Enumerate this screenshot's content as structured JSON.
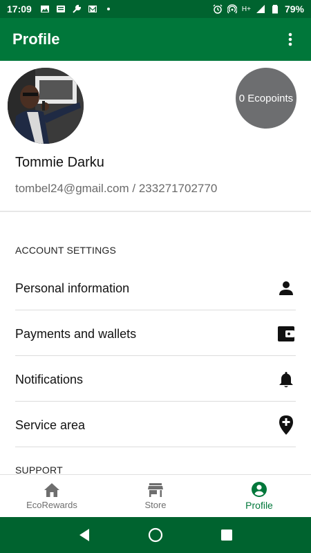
{
  "status_bar": {
    "time": "17:09",
    "battery": "79%",
    "left_icons": [
      "image-icon",
      "news-icon",
      "wrench-icon",
      "gmail-icon",
      "dot-icon"
    ],
    "right_icons": [
      "alarm-icon",
      "hotspot-icon",
      "signal-h-plus-icon",
      "cell-signal-icon",
      "battery-icon"
    ],
    "network_label": "H+"
  },
  "app_bar": {
    "title": "Profile"
  },
  "profile": {
    "ecopoints": "0 Ecopoints",
    "name": "Tommie Darku",
    "contact": "tombel24@gmail.com / 233271702770"
  },
  "sections": {
    "account_settings": "ACCOUNT SETTINGS",
    "support": "SUPPORT"
  },
  "settings_items": [
    {
      "label": "Personal information",
      "icon": "person-icon"
    },
    {
      "label": "Payments and wallets",
      "icon": "wallet-icon"
    },
    {
      "label": "Notifications",
      "icon": "bell-icon"
    },
    {
      "label": "Service area",
      "icon": "location-add-icon"
    }
  ],
  "bottom_nav": [
    {
      "label": "EcoRewards",
      "icon": "home-icon",
      "active": false
    },
    {
      "label": "Store",
      "icon": "store-icon",
      "active": false
    },
    {
      "label": "Profile",
      "icon": "account-circle-icon",
      "active": true
    }
  ],
  "colors": {
    "status_bar": "#00632f",
    "app_bar": "#00773a",
    "accent": "#00773a",
    "ecopoints_bg": "#6d6e70"
  }
}
